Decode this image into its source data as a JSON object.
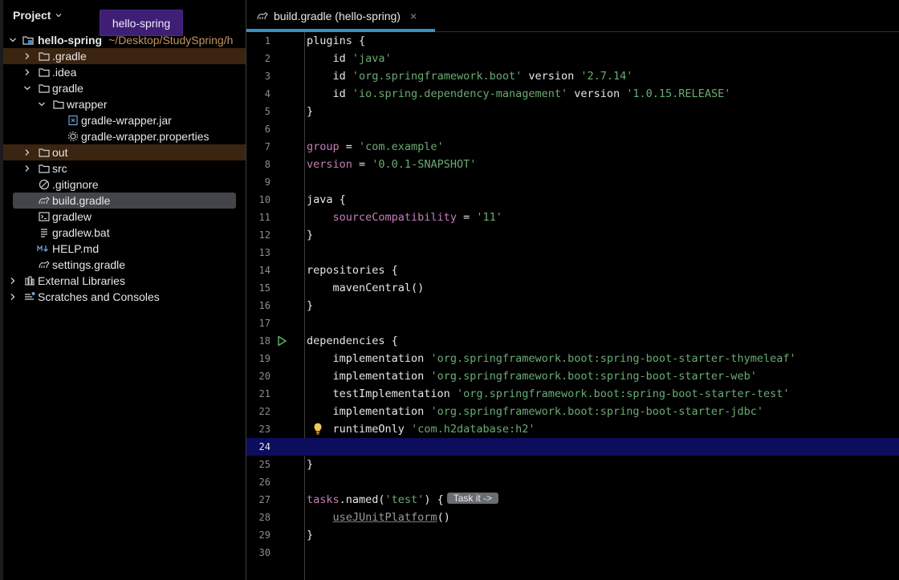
{
  "project_panel": {
    "title": "Project",
    "tooltip": "hello-spring",
    "tree": [
      {
        "name": "hello-spring",
        "path": "~/Desktop/StudySpring/h",
        "icon": "module-folder-icon",
        "expanded": true
      },
      {
        "name": ".gradle",
        "icon": "folder-icon"
      },
      {
        "name": ".idea",
        "icon": "folder-icon"
      },
      {
        "name": "gradle",
        "icon": "folder-icon",
        "expanded": true
      },
      {
        "name": "wrapper",
        "icon": "folder-icon",
        "expanded": true
      },
      {
        "name": "gradle-wrapper.jar",
        "icon": "jar-icon"
      },
      {
        "name": "gradle-wrapper.properties",
        "icon": "properties-gear-icon"
      },
      {
        "name": "out",
        "icon": "folder-icon"
      },
      {
        "name": "src",
        "icon": "folder-icon"
      },
      {
        "name": ".gitignore",
        "icon": "gitignore-icon"
      },
      {
        "name": "build.gradle",
        "icon": "gradle-icon",
        "selected": true
      },
      {
        "name": "gradlew",
        "icon": "terminal-icon"
      },
      {
        "name": "gradlew.bat",
        "icon": "text-file-icon"
      },
      {
        "name": "HELP.md",
        "icon": "markdown-icon"
      },
      {
        "name": "settings.gradle",
        "icon": "gradle-icon"
      },
      {
        "name": "External Libraries",
        "icon": "libraries-icon"
      },
      {
        "name": "Scratches and Consoles",
        "icon": "scratches-icon"
      }
    ]
  },
  "editor": {
    "tab": {
      "label": "build.gradle (hello-spring)",
      "close": "×"
    },
    "current_line": 24,
    "inlay_hint": "Task it ->",
    "lines": [
      "1",
      "2",
      "3",
      "4",
      "5",
      "6",
      "7",
      "8",
      "9",
      "10",
      "11",
      "12",
      "13",
      "14",
      "15",
      "16",
      "17",
      "18",
      "19",
      "20",
      "21",
      "22",
      "23",
      "24",
      "25",
      "26",
      "27",
      "28",
      "29",
      "30"
    ],
    "code": {
      "l1_plugins": "plugins {",
      "l2_id": "id ",
      "l2_val": "'java'",
      "l3_id": "id ",
      "l3_val": "'org.springframework.boot'",
      "l3_ver_kw": " version ",
      "l3_ver": "'2.7.14'",
      "l4_id": "id ",
      "l4_val": "'io.spring.dependency-management'",
      "l4_ver_kw": " version ",
      "l4_ver": "'1.0.15.RELEASE'",
      "close": "}",
      "l7_group": "group",
      "eq": " = ",
      "l7_val": "'com.example'",
      "l8_version": "version",
      "l8_val": "'0.0.1-SNAPSHOT'",
      "l10_java": "java {",
      "l11_sc": "sourceCompatibility",
      "l11_val": "'11'",
      "l14_repos": "repositories {",
      "l15_maven": "mavenCentral()",
      "l18_deps": "dependencies {",
      "l19_impl": "implementation ",
      "l19_val": "'org.springframework.boot:spring-boot-starter-thymeleaf'",
      "l20_impl": "implementation ",
      "l20_val": "'org.springframework.boot:spring-boot-starter-web'",
      "l21_test": "testImplementation ",
      "l21_val": "'org.springframework.boot:spring-boot-starter-test'",
      "l22_impl": "implementation ",
      "l22_val": "'org.springframework.boot:spring-boot-starter-jdbc'",
      "l23_rt": "runtimeOnly ",
      "l23_val": "'com.h2database:h2'",
      "l27_tasks": "tasks",
      "l27_named": ".named(",
      "l27_val": "'test'",
      "l27_end": ") {",
      "l28_junit": "useJUnitPlatform",
      "l28_paren": "()"
    }
  }
}
